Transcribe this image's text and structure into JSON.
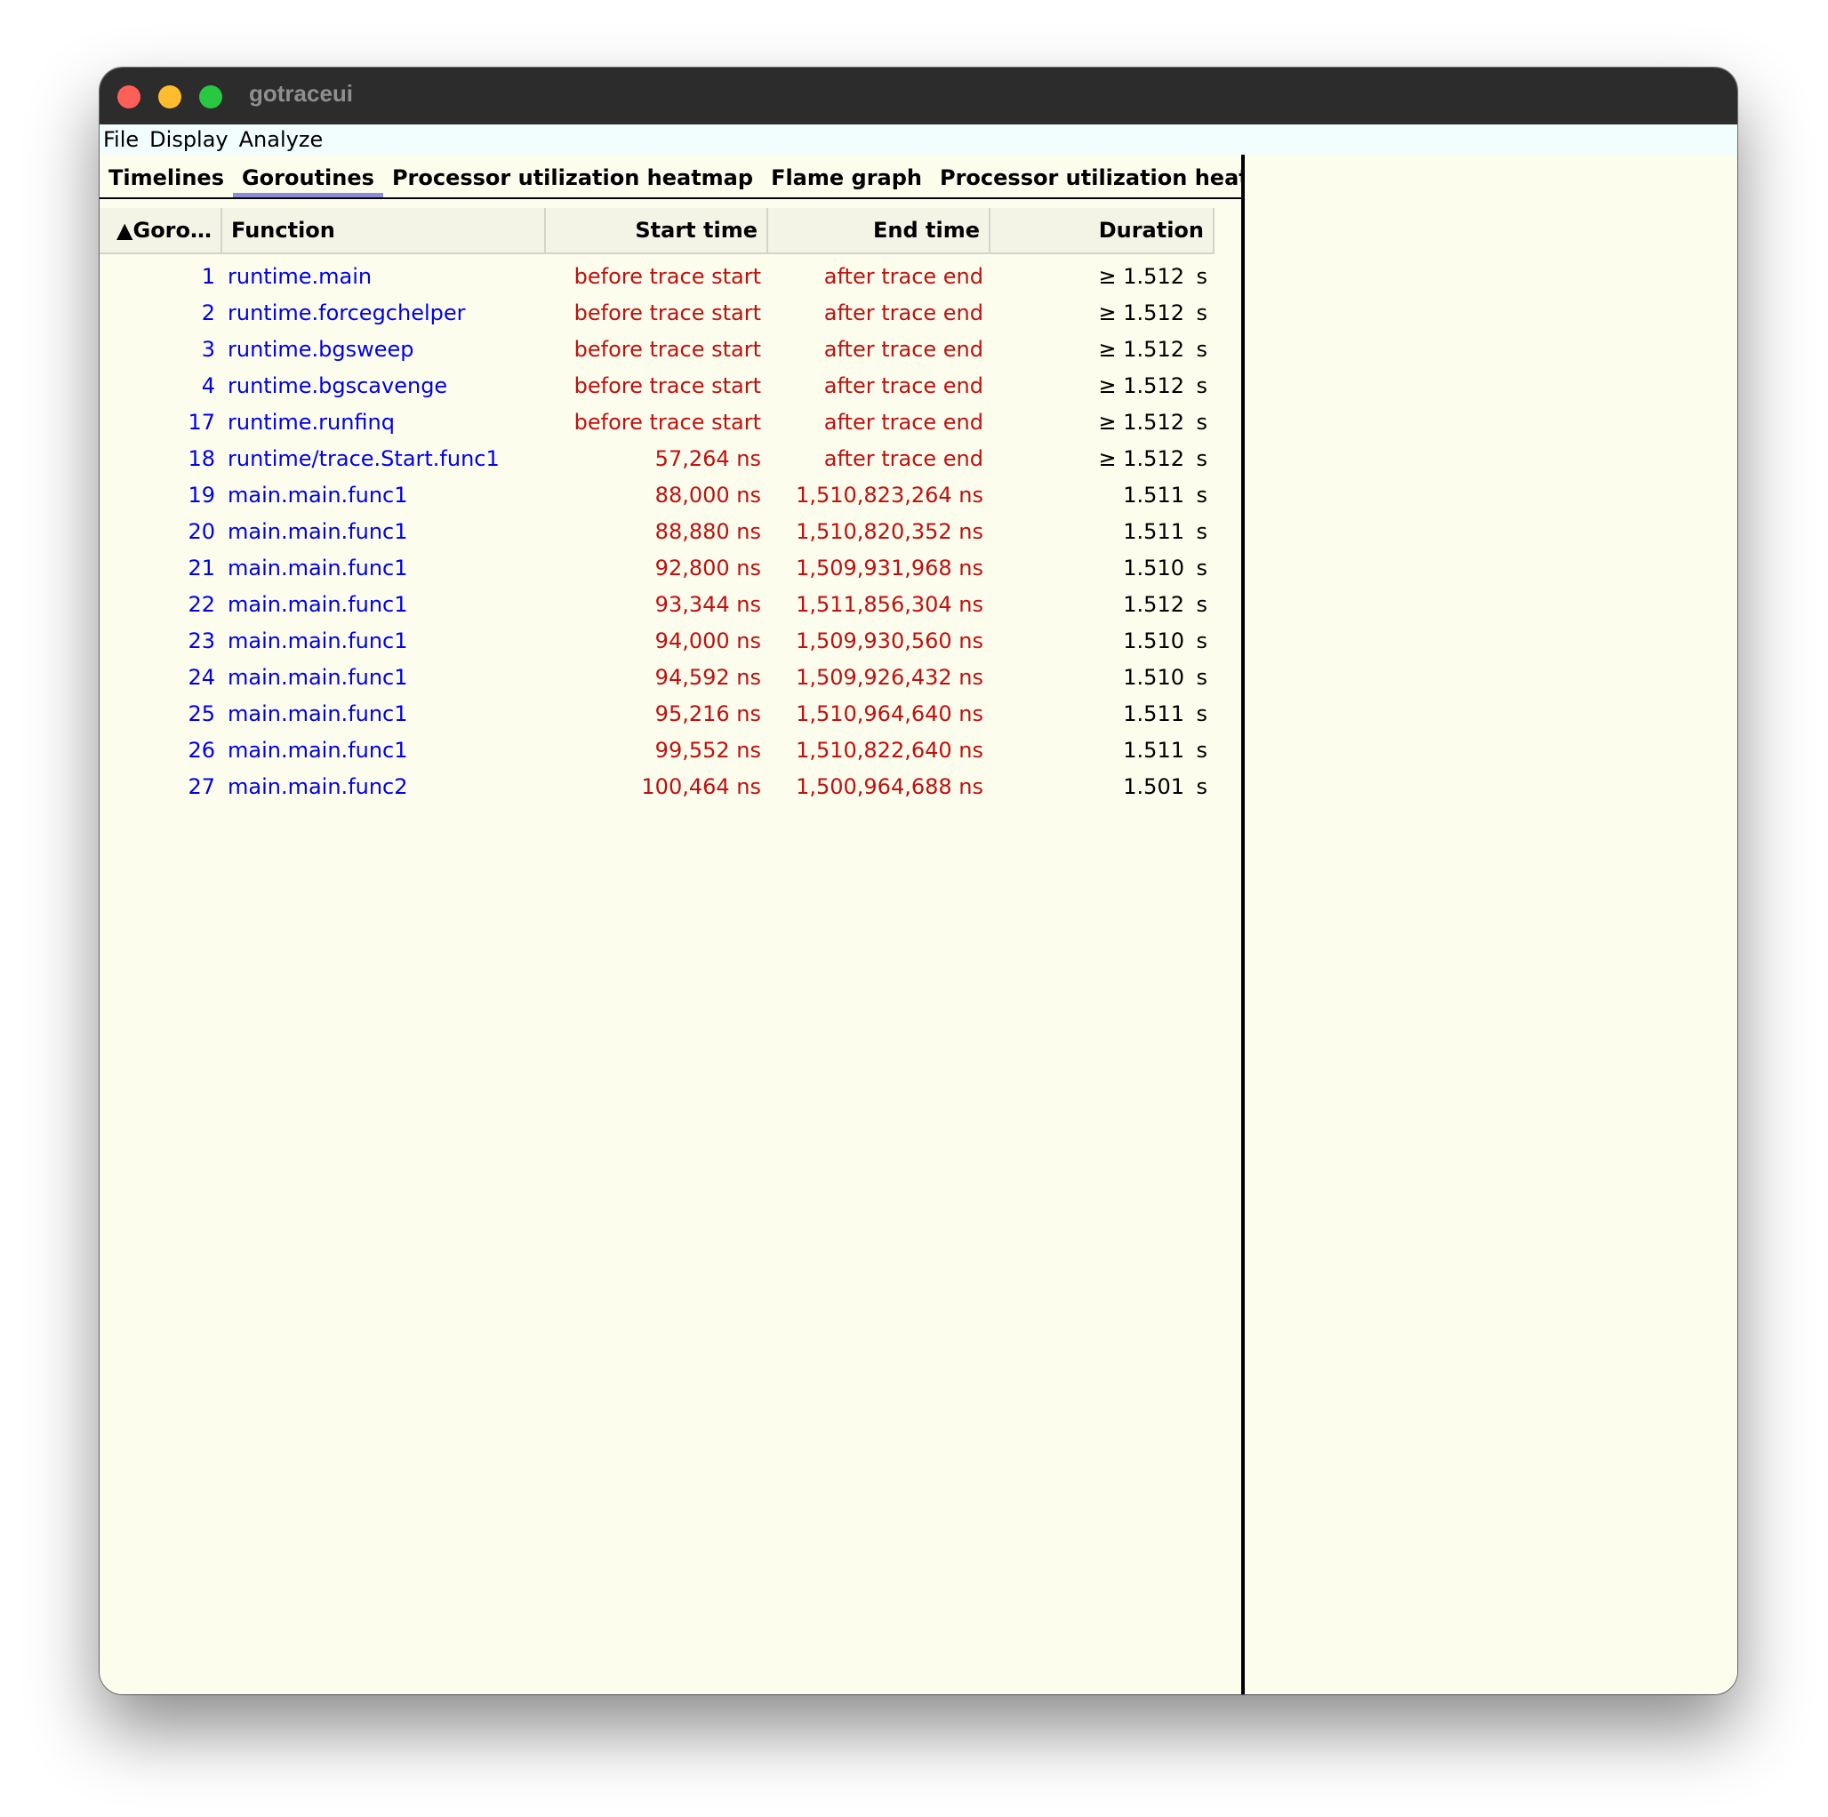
{
  "app": {
    "title": "gotraceui"
  },
  "menu": [
    "File",
    "Display",
    "Analyze"
  ],
  "tabs": [
    {
      "label": "Timelines",
      "active": false
    },
    {
      "label": "Goroutines",
      "active": true
    },
    {
      "label": "Processor utilization heatmap",
      "active": false
    },
    {
      "label": "Flame graph",
      "active": false
    },
    {
      "label": "Processor utilization heatmap",
      "active": false
    }
  ],
  "table": {
    "columns": [
      "▲Goro…",
      "Function",
      "Start time",
      "End time",
      "Duration"
    ],
    "rows": [
      {
        "id": "1",
        "fn": "runtime.main",
        "start": "before trace start",
        "end": "after trace end",
        "dur": "≥ 1.512",
        "unit": "s"
      },
      {
        "id": "2",
        "fn": "runtime.forcegchelper",
        "start": "before trace start",
        "end": "after trace end",
        "dur": "≥ 1.512",
        "unit": "s"
      },
      {
        "id": "3",
        "fn": "runtime.bgsweep",
        "start": "before trace start",
        "end": "after trace end",
        "dur": "≥ 1.512",
        "unit": "s"
      },
      {
        "id": "4",
        "fn": "runtime.bgscavenge",
        "start": "before trace start",
        "end": "after trace end",
        "dur": "≥ 1.512",
        "unit": "s"
      },
      {
        "id": "17",
        "fn": "runtime.runfinq",
        "start": "before trace start",
        "end": "after trace end",
        "dur": "≥ 1.512",
        "unit": "s"
      },
      {
        "id": "18",
        "fn": "runtime/trace.Start.func1",
        "start": "57,264 ns",
        "end": "after trace end",
        "dur": "≥ 1.512",
        "unit": "s"
      },
      {
        "id": "19",
        "fn": "main.main.func1",
        "start": "88,000 ns",
        "end": "1,510,823,264 ns",
        "dur": "1.511",
        "unit": "s"
      },
      {
        "id": "20",
        "fn": "main.main.func1",
        "start": "88,880 ns",
        "end": "1,510,820,352 ns",
        "dur": "1.511",
        "unit": "s"
      },
      {
        "id": "21",
        "fn": "main.main.func1",
        "start": "92,800 ns",
        "end": "1,509,931,968 ns",
        "dur": "1.510",
        "unit": "s"
      },
      {
        "id": "22",
        "fn": "main.main.func1",
        "start": "93,344 ns",
        "end": "1,511,856,304 ns",
        "dur": "1.512",
        "unit": "s"
      },
      {
        "id": "23",
        "fn": "main.main.func1",
        "start": "94,000 ns",
        "end": "1,509,930,560 ns",
        "dur": "1.510",
        "unit": "s"
      },
      {
        "id": "24",
        "fn": "main.main.func1",
        "start": "94,592 ns",
        "end": "1,509,926,432 ns",
        "dur": "1.510",
        "unit": "s"
      },
      {
        "id": "25",
        "fn": "main.main.func1",
        "start": "95,216 ns",
        "end": "1,510,964,640 ns",
        "dur": "1.511",
        "unit": "s"
      },
      {
        "id": "26",
        "fn": "main.main.func1",
        "start": "99,552 ns",
        "end": "1,510,822,640 ns",
        "dur": "1.511",
        "unit": "s"
      },
      {
        "id": "27",
        "fn": "main.main.func2",
        "start": "100,464 ns",
        "end": "1,500,964,688 ns",
        "dur": "1.501",
        "unit": "s"
      }
    ]
  }
}
